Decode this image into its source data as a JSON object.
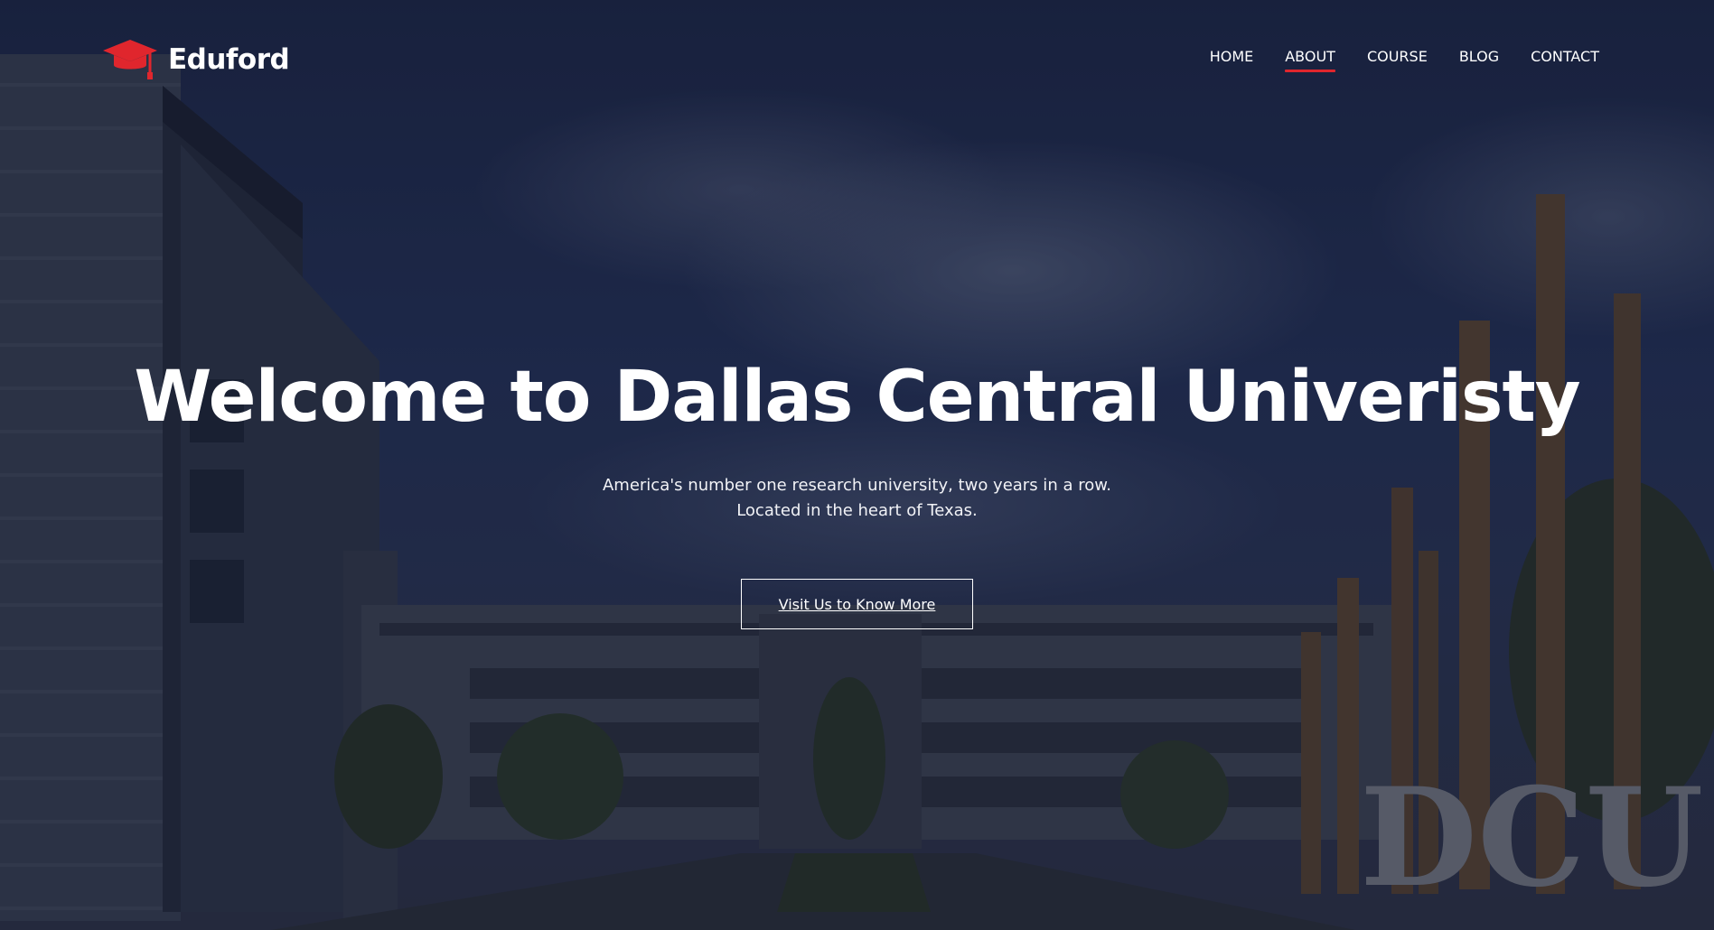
{
  "brand": {
    "name": "Eduford",
    "logo_icon": "graduation-cap-icon",
    "accent_color": "#e0262d"
  },
  "nav": {
    "items": [
      {
        "label": "HOME"
      },
      {
        "label": "ABOUT",
        "active": true
      },
      {
        "label": "COURSE"
      },
      {
        "label": "BLOG"
      },
      {
        "label": "CONTACT"
      }
    ]
  },
  "hero": {
    "title": "Welcome to Dallas Central Univeristy",
    "subtitle_line1": "America's number one research university, two years in a row.",
    "subtitle_line2": "Located in the heart of Texas.",
    "cta_label": "Visit Us to Know More",
    "sign_text": "DCU"
  }
}
